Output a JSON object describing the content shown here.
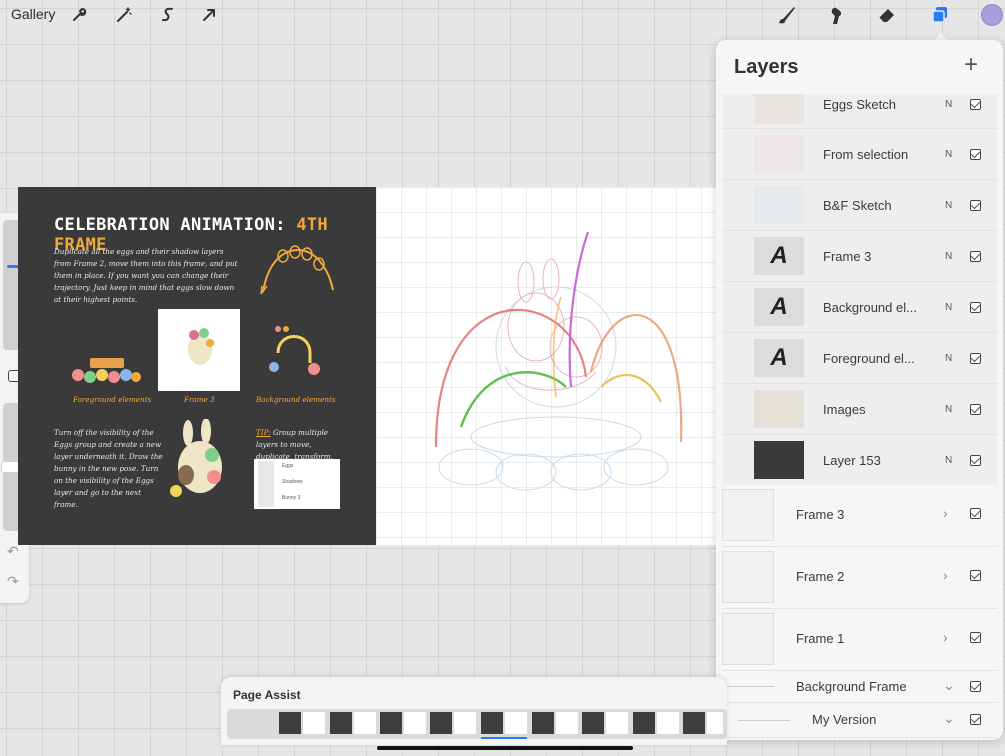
{
  "toolbar": {
    "gallery": "Gallery",
    "tools": [
      "wrench-icon",
      "magic-wand-icon",
      "selection-icon",
      "transform-arrow-icon"
    ],
    "right_tools": [
      "brush-icon",
      "smudge-icon",
      "eraser-icon",
      "layers-icon"
    ],
    "accent": "#2b7cf4",
    "color_swatch": "#a7a0d8"
  },
  "reference": {
    "title_main": "CELEBRATION ANIMATION:",
    "title_accent": "4TH FRAME",
    "instructions": "Duplicate all the eggs and their shadow layers from Frame 2, move them into this frame, and put them in place. If you want you can change their trajectory. Just keep in mind that eggs slow down at their highest points.",
    "label_foreground": "Foreground elements",
    "label_frame": "Frame 3",
    "label_background": "Background elements",
    "bunny_text": "Turn off the visibility of the Eggs group and create a new layer underneath it. Draw the bunny in the new pose. Turn on the visibility of the Eggs layer and go to the next frame.",
    "tip_label": "TIP:",
    "tip_text": "Group multiple layers to move, duplicate, transform, and change their visibility faster.",
    "mini_layers": [
      "Eggs",
      "Shadows",
      "Bunny 3"
    ]
  },
  "layers": {
    "title": "Layers",
    "add_button": "+",
    "items": [
      {
        "name": "Eggs Sketch",
        "blend": "N",
        "visible": true
      },
      {
        "name": "From selection",
        "blend": "N",
        "visible": true
      },
      {
        "name": "B&F Sketch",
        "blend": "N",
        "visible": true
      },
      {
        "name": "Frame 3",
        "blend": "N",
        "visible": true
      },
      {
        "name": "Background el...",
        "blend": "N",
        "visible": true
      },
      {
        "name": "Foreground el...",
        "blend": "N",
        "visible": true
      },
      {
        "name": "Images",
        "blend": "N",
        "visible": true
      },
      {
        "name": "Layer 153",
        "blend": "N",
        "visible": true
      }
    ],
    "groups": [
      {
        "name": "Frame 3",
        "expanded": false,
        "visible": true
      },
      {
        "name": "Frame 2",
        "expanded": false,
        "visible": true
      },
      {
        "name": "Frame 1",
        "expanded": false,
        "visible": true
      },
      {
        "name": "Background Frame",
        "expanded": true,
        "visible": true
      },
      {
        "name": "My Version",
        "expanded": true,
        "visible": true
      }
    ]
  },
  "page_assist": {
    "title": "Page Assist",
    "frame_count": 9,
    "selected_frame": 4
  }
}
